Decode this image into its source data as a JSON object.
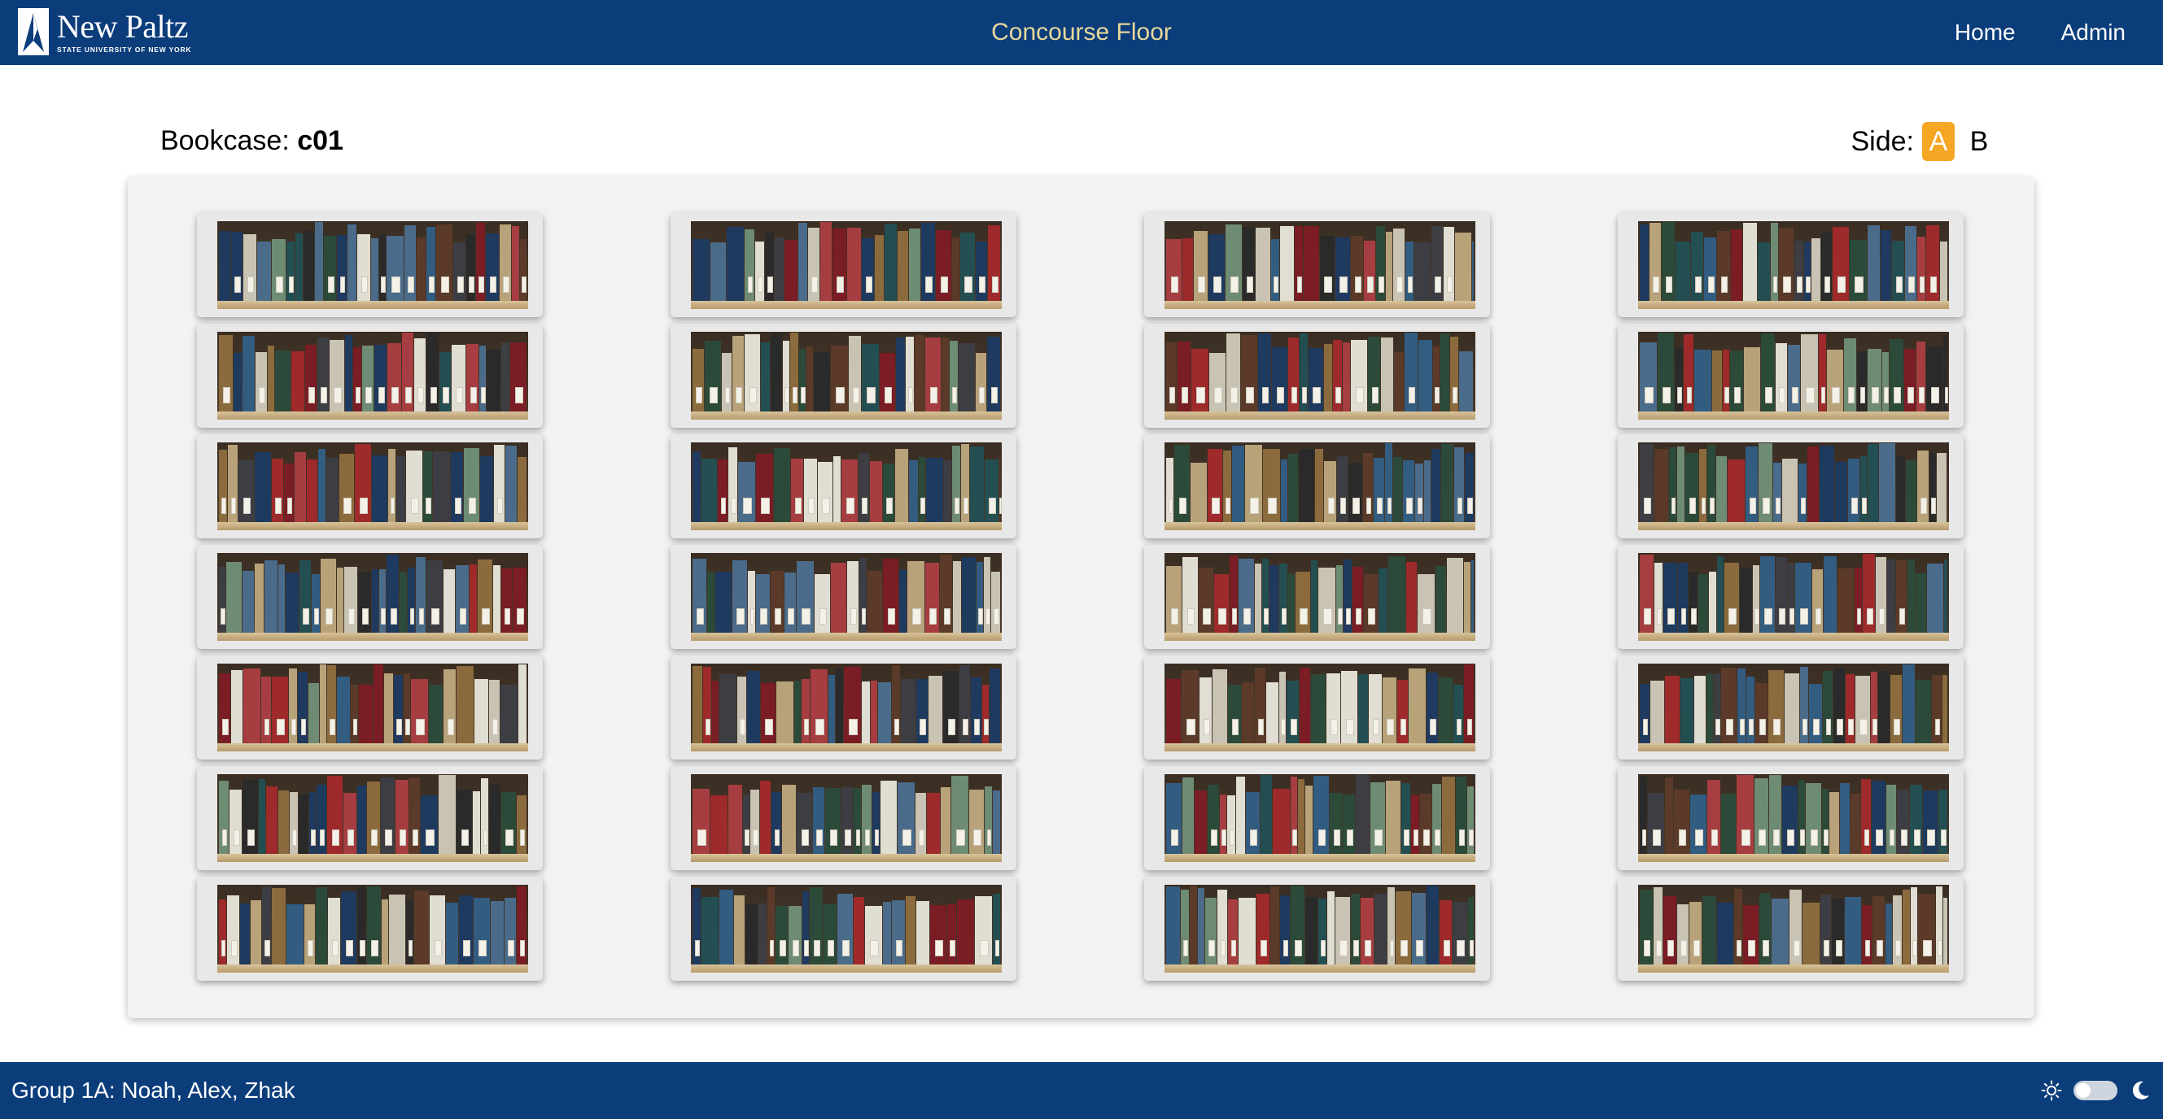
{
  "header": {
    "logo": {
      "name": "New Paltz",
      "subtitle": "STATE UNIVERSITY OF NEW YORK"
    },
    "page_title": "Concourse Floor",
    "nav": [
      {
        "label": "Home"
      },
      {
        "label": "Admin"
      }
    ]
  },
  "bookcase": {
    "label": "Bookcase:",
    "id": "c01",
    "side_label": "Side:",
    "sides": [
      {
        "label": "A",
        "selected": true
      },
      {
        "label": "B",
        "selected": false
      }
    ]
  },
  "shelves": {
    "columns": 4,
    "rows_per_column": 7,
    "images": "bookshelf-photo"
  },
  "footer": {
    "team": "Group 1A: Noah, Alex, Zhak",
    "theme_toggle": {
      "light_icon": "sun-icon",
      "dark_icon": "moon-icon",
      "dark_mode": false
    }
  },
  "colors": {
    "header_bg": "#0b3d7b",
    "title_text": "#e8d89a",
    "side_active": "#f5a623"
  }
}
